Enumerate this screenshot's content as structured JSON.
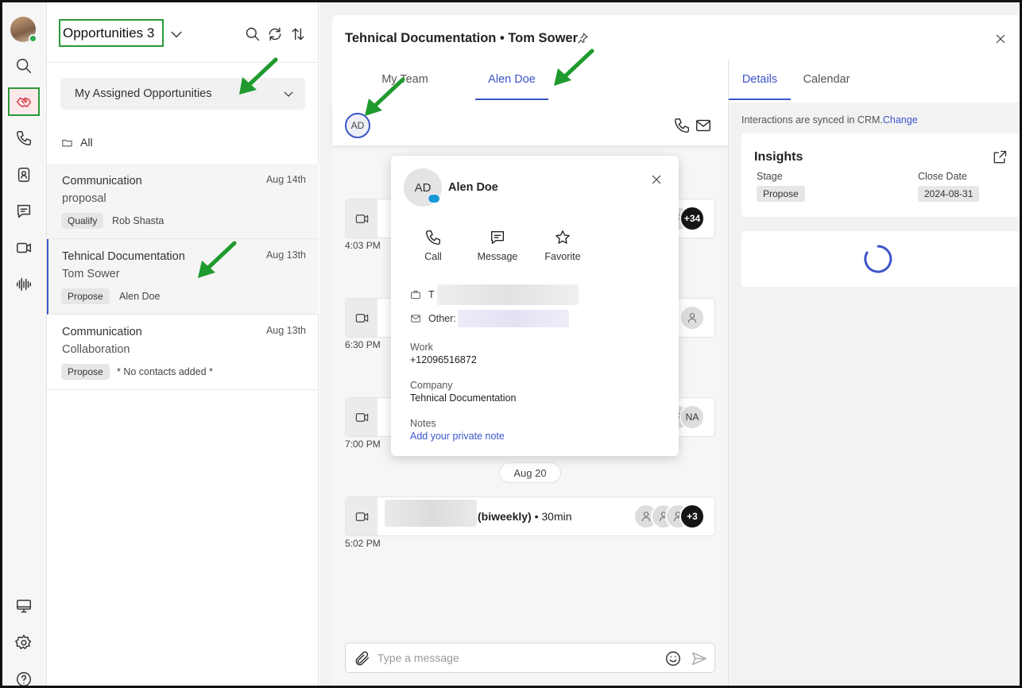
{
  "sidebar": {
    "icons": [
      "avatar",
      "search-icon",
      "handshake-icon",
      "phone-icon",
      "contacts-icon",
      "chat-icon",
      "video-icon",
      "waveform-icon",
      "monitor-icon",
      "gear-icon",
      "help-icon"
    ]
  },
  "list": {
    "title": "Opportunities 3",
    "filter": "My Assigned Opportunities",
    "all_label": "All",
    "items": [
      {
        "line1": "Communication",
        "line2": "proposal",
        "date": "Aug 14th",
        "stage": "Qualify",
        "owner": "Rob Shasta"
      },
      {
        "line1": "Tehnical Documentation",
        "line2": "Tom Sower",
        "date": "Aug 13th",
        "stage": "Propose",
        "owner": "Alen Doe"
      },
      {
        "line1": "Communication",
        "line2": "Collaboration",
        "date": "Aug 13th",
        "stage": "Propose",
        "owner": "* No contacts added *"
      }
    ]
  },
  "chat": {
    "title": "Tehnical Documentation • Tom Sower",
    "tabs": [
      "My Team",
      "Alen Doe"
    ],
    "member_initials": "AD",
    "events": [
      {
        "time": "4:03 PM",
        "extra_count": "+34"
      },
      {
        "time": "6:30 PM"
      },
      {
        "time": "7:00 PM",
        "initials": "NA"
      },
      {
        "time": "5:02 PM",
        "title_suffix": "(biweekly)",
        "duration": "• 30min",
        "extra_count": "+3"
      }
    ],
    "date_divider": "Aug 20",
    "composer_placeholder": "Type a message"
  },
  "popover": {
    "initials": "AD",
    "name": "Alen Doe",
    "actions": [
      "Call",
      "Message",
      "Favorite"
    ],
    "row1_prefix": "T",
    "row2_label": "Other:",
    "work_label": "Work",
    "work_value": "+12096516872",
    "company_label": "Company",
    "company_value": "Tehnical Documentation",
    "notes_label": "Notes",
    "notes_link": "Add your private note"
  },
  "details": {
    "tabs": [
      "Details",
      "Calendar"
    ],
    "sync_text": "Interactions are synced in CRM.",
    "sync_link": "Change",
    "insights_title": "Insights",
    "stage_label": "Stage",
    "stage_value": "Propose",
    "close_label": "Close Date",
    "close_value": "2024-08-31"
  },
  "colors": {
    "accent": "#3b55c9",
    "highlight_green": "#2a9a3a",
    "arrow_green": "#1f9a2e"
  }
}
